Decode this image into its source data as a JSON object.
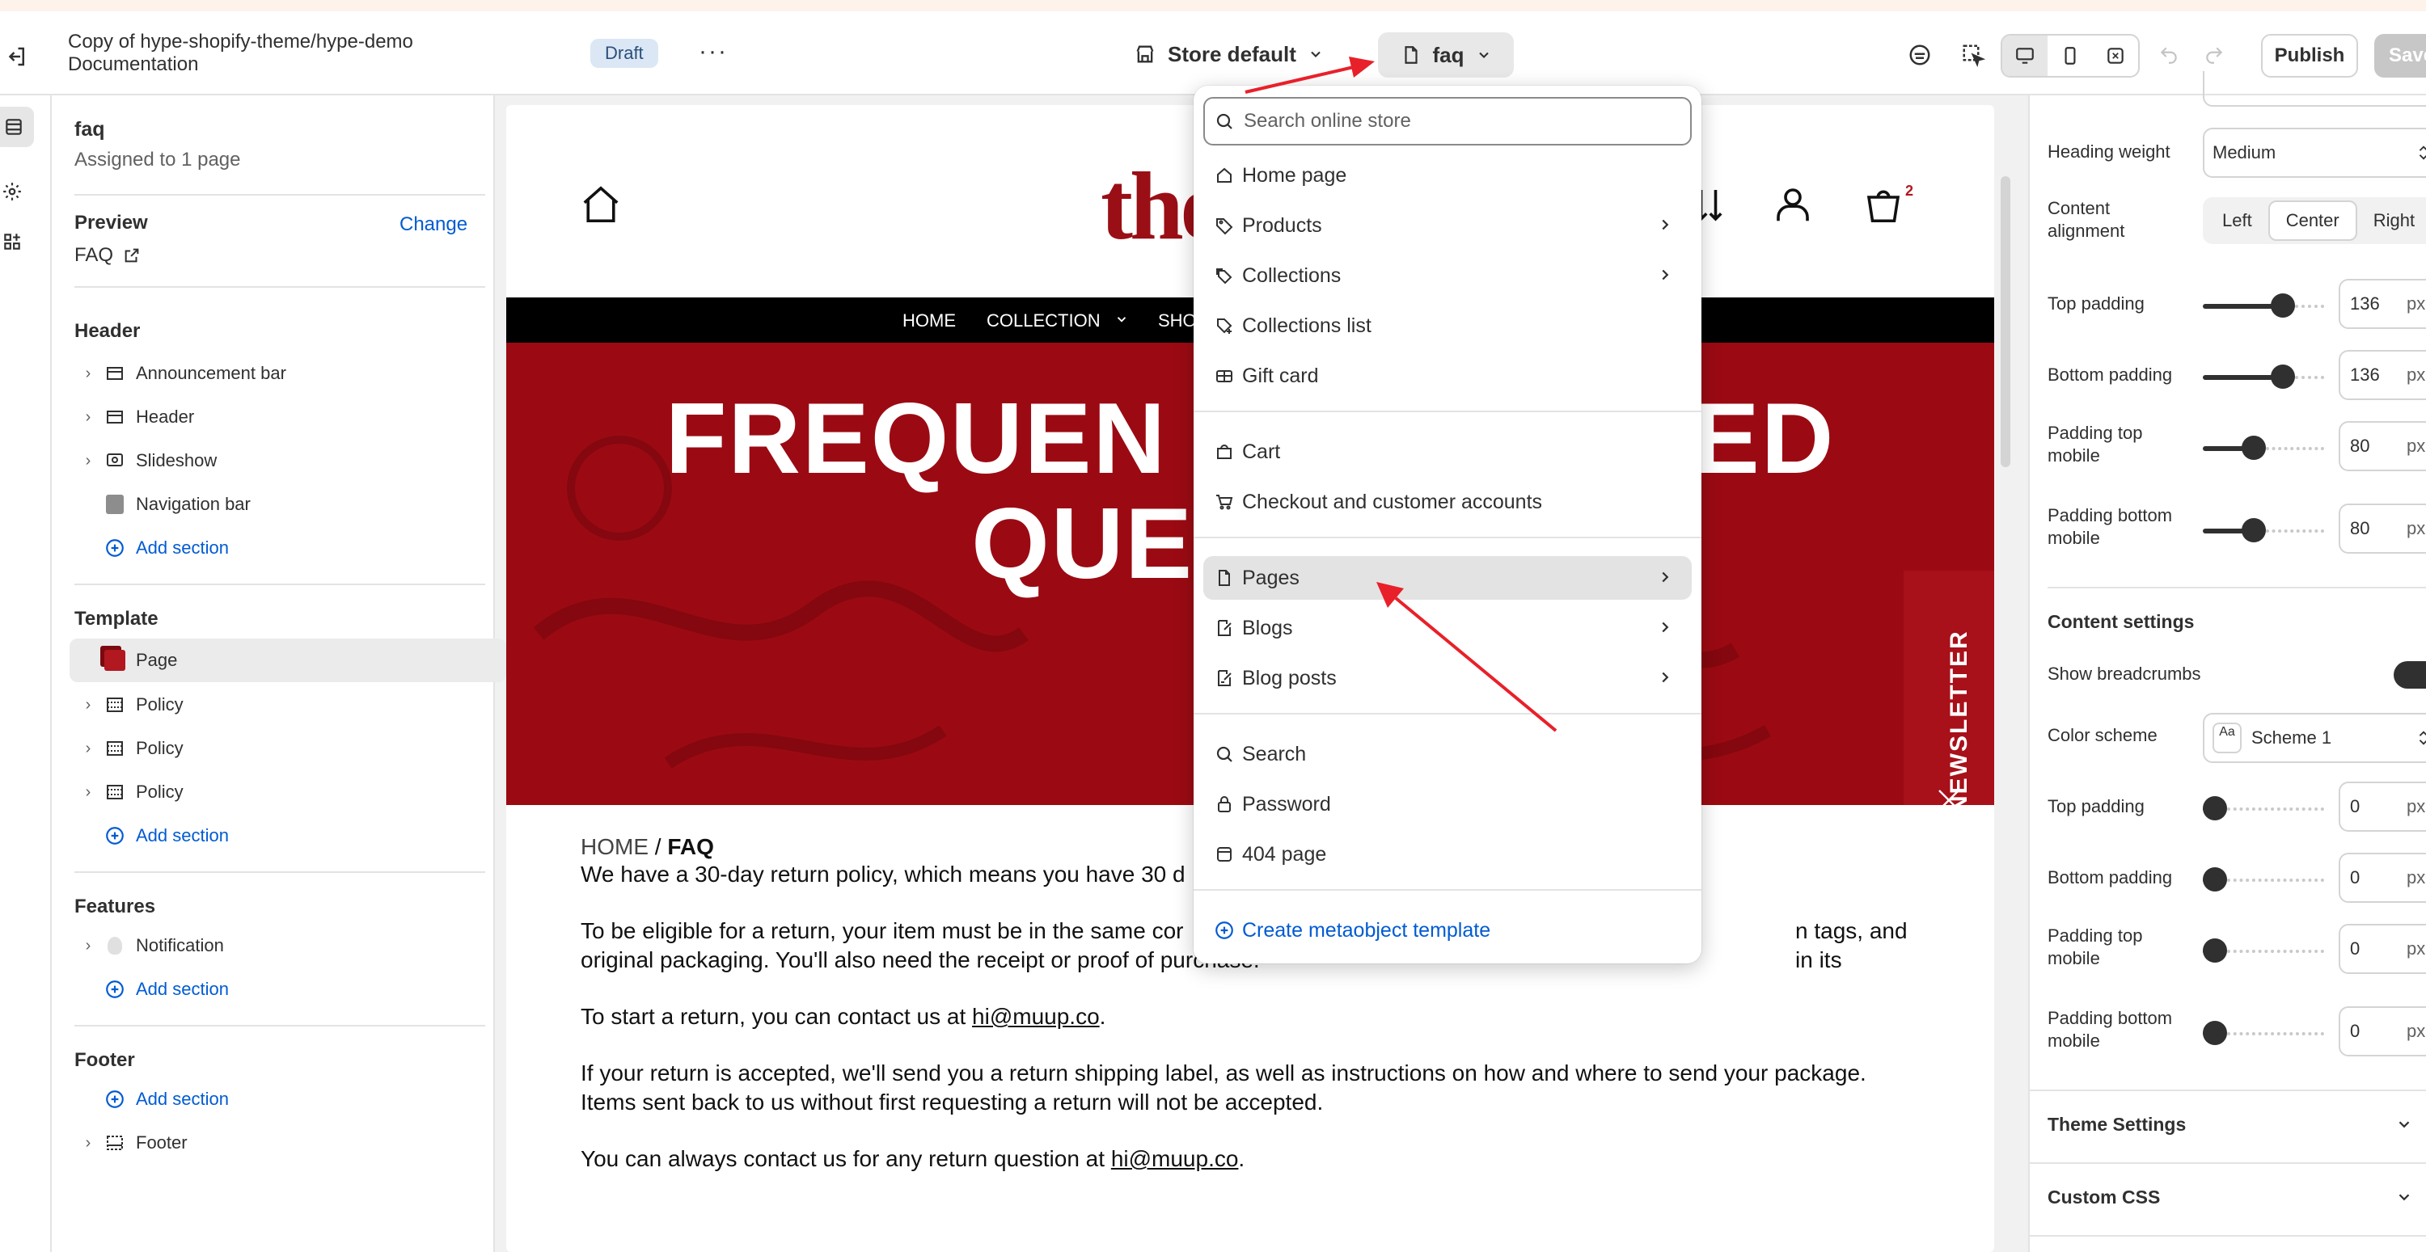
{
  "topbar": {
    "title_line1": "Copy of hype-shopify-theme/hype-demo",
    "title_line2": "Documentation",
    "draft_badge": "Draft",
    "more_label": "···",
    "store_selector": "Store default",
    "page_selector": "faq",
    "publish_label": "Publish",
    "save_label": "Save"
  },
  "left_panel": {
    "page_name": "faq",
    "assigned": "Assigned to 1 page",
    "preview_label": "Preview",
    "change_label": "Change",
    "preview_page": "FAQ",
    "header_group": {
      "title": "Header",
      "items": [
        "Announcement bar",
        "Header",
        "Slideshow",
        "Navigation bar"
      ],
      "add_label": "Add section"
    },
    "template_group": {
      "title": "Template",
      "items": [
        "Page",
        "Policy",
        "Policy",
        "Policy"
      ],
      "add_label": "Add section"
    },
    "features_group": {
      "title": "Features",
      "items": [
        "Notification"
      ],
      "add_label": "Add section"
    },
    "footer_group": {
      "title": "Footer",
      "add_label": "Add section",
      "items": [
        "Footer"
      ]
    }
  },
  "preview": {
    "logo_text": "the",
    "cart_count": "2",
    "nav": [
      "HOME",
      "COLLECTION",
      "SHO"
    ],
    "hero_line1": "FREQUEN",
    "hero_line1_end": "ED",
    "hero_line2": "QUES",
    "newsletter_label": "NEWSLETTER",
    "breadcrumb_home": "HOME",
    "breadcrumb_sep": "/",
    "breadcrumb_current": "FAQ",
    "para1": "We have a 30-day return policy, which means you have 30 d",
    "para2a": "To be eligible for a return, your item must be in the same cor",
    "para2b_end": "n tags, and in its",
    "para2c": "original packaging. You'll also need the receipt or proof of purchase.",
    "para3_prefix": "To start a return, you can contact us at ",
    "email": "hi@muup.co",
    "para3_suffix": ".",
    "para4a": "If your return is accepted, we'll send you a return shipping label, as well as instructions on how and where to send your package.",
    "para4b": "Items sent back to us without first requesting a return will not be accepted.",
    "para5_prefix": "You can always contact us for any return question at ",
    "para5_suffix": "."
  },
  "dropdown": {
    "search_placeholder": "Search online store",
    "group1": [
      "Home page",
      "Products",
      "Collections",
      "Collections list",
      "Gift card"
    ],
    "group2": [
      "Cart",
      "Checkout and customer accounts"
    ],
    "group3": [
      "Pages",
      "Blogs",
      "Blog posts"
    ],
    "group4": [
      "Search",
      "Password",
      "404 page"
    ],
    "create_label": "Create metaobject template"
  },
  "right_panel": {
    "heading_weight_label": "Heading weight",
    "heading_weight_value": "Medium",
    "content_alignment_label1": "Content",
    "content_alignment_label2": "alignment",
    "alignment_options": [
      "Left",
      "Center",
      "Right"
    ],
    "alignment_selected": "Center",
    "top_padding_label": "Top padding",
    "top_padding_value": "136",
    "top_padding_level": 0.7,
    "bottom_padding_label": "Bottom padding",
    "bottom_padding_value": "136",
    "bottom_padding_level": 0.7,
    "padding_top_mobile_label1": "Padding top",
    "padding_top_mobile_label2": "mobile",
    "padding_top_mobile_value": "80",
    "padding_top_mobile_level": 0.4,
    "padding_bottom_mobile_label1": "Padding bottom",
    "padding_bottom_mobile_label2": "mobile",
    "padding_bottom_mobile_value": "80",
    "padding_bottom_mobile_level": 0.4,
    "unit": "px",
    "content_settings_title": "Content settings",
    "show_breadcrumbs_label": "Show breadcrumbs",
    "color_scheme_label": "Color scheme",
    "color_scheme_value": "Scheme 1",
    "color_scheme_icon_text": "Aa",
    "cs_top_padding_label": "Top padding",
    "cs_top_padding_value": "0",
    "cs_bottom_padding_label": "Bottom padding",
    "cs_bottom_padding_value": "0",
    "cs_padding_top_mobile_label1": "Padding top",
    "cs_padding_top_mobile_label2": "mobile",
    "cs_padding_top_mobile_value": "0",
    "cs_padding_bottom_mobile_label1": "Padding bottom",
    "cs_padding_bottom_mobile_label2": "mobile",
    "cs_padding_bottom_mobile_value": "0",
    "theme_settings_label": "Theme Settings",
    "custom_css_label": "Custom CSS"
  },
  "colors": {
    "brand_red": "#9b0a13",
    "link_blue": "#005bd3",
    "arrow_red": "#e8202a"
  }
}
